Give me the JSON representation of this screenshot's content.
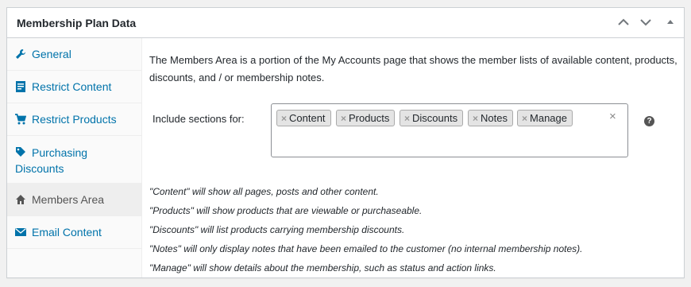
{
  "panel": {
    "title": "Membership Plan Data",
    "controls": [
      "move-up-icon",
      "move-down-icon",
      "toggle-arrow-icon"
    ]
  },
  "sidebar": {
    "items": [
      {
        "label": "General",
        "icon": "wrench-icon"
      },
      {
        "label": "Restrict Content",
        "icon": "page-icon"
      },
      {
        "label": "Restrict Products",
        "icon": "cart-icon"
      },
      {
        "label": "Purchasing Discounts",
        "icon": "tag-icon"
      },
      {
        "label": "Members Area",
        "icon": "home-icon",
        "active": true
      },
      {
        "label": "Email Content",
        "icon": "email-icon"
      }
    ]
  },
  "main": {
    "intro": "The Members Area is a portion of the My Accounts page that shows the member lists of available content, products, discounts, and / or membership notes.",
    "field_label": "Include sections for:",
    "chips": [
      "Content",
      "Products",
      "Discounts",
      "Notes",
      "Manage"
    ],
    "chip_remove": "×",
    "clear": "×",
    "help": "?",
    "notes": [
      "\"Content\" will show all pages, posts and other content.",
      "\"Products\" will show products that are viewable or purchaseable.",
      "\"Discounts\" will list products carrying membership discounts.",
      "\"Notes\" will only display notes that have been emailed to the customer (no internal membership notes).",
      "\"Manage\" will show details about the membership, such as status and action links."
    ]
  },
  "colors": {
    "link": "#0073aa",
    "active_bg": "#eeeeee",
    "border": "#ccd0d4"
  }
}
